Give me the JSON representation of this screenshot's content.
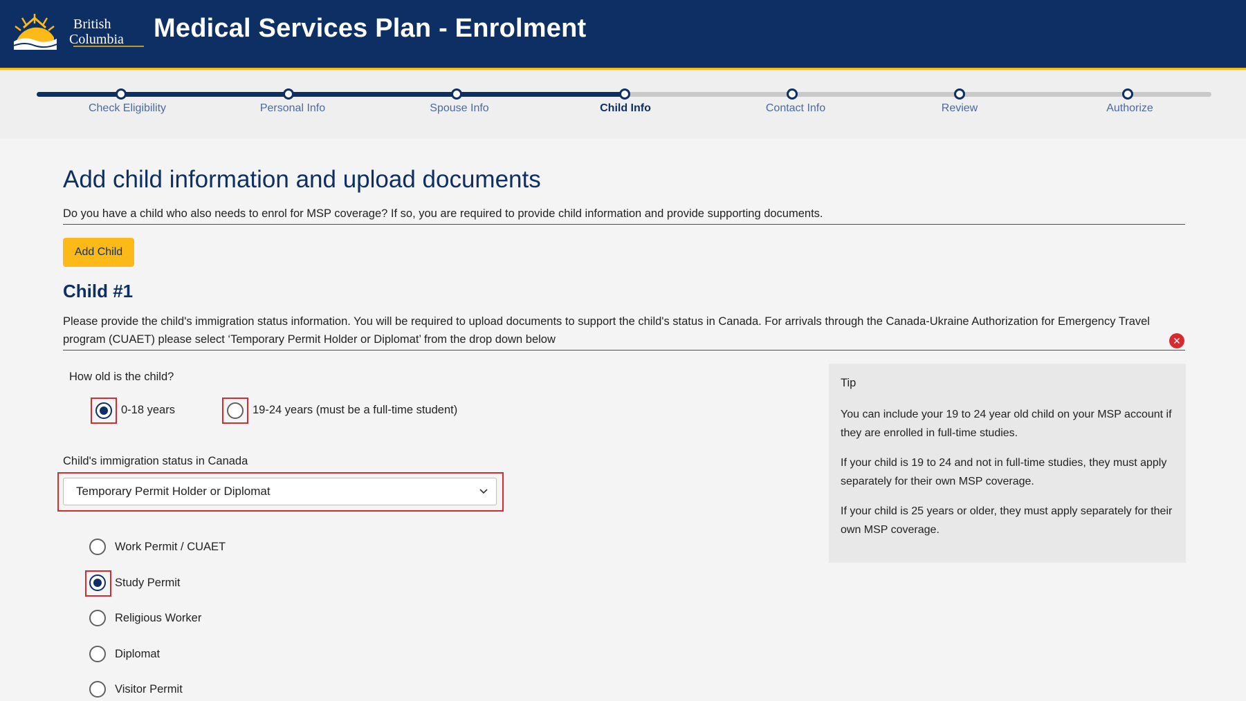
{
  "header": {
    "logo_line1": "British",
    "logo_line2": "Columbia",
    "title": "Medical Services Plan - Enrolment"
  },
  "stepper": {
    "steps": [
      {
        "label": "Check Eligibility",
        "state": "complete"
      },
      {
        "label": "Personal Info",
        "state": "complete"
      },
      {
        "label": "Spouse Info",
        "state": "complete"
      },
      {
        "label": "Child Info",
        "state": "current"
      },
      {
        "label": "Contact Info",
        "state": "upcoming"
      },
      {
        "label": "Review",
        "state": "upcoming"
      },
      {
        "label": "Authorize",
        "state": "upcoming"
      }
    ]
  },
  "main": {
    "title": "Add child information and upload documents",
    "intro": "Do you have a child who also needs to enrol for MSP coverage? If so, you are required to provide child information and provide supporting documents.",
    "add_child_label": "Add Child",
    "child_title": "Child #1",
    "child_desc": "Please provide the child's immigration status information. You will be required to upload documents to support the child's status in Canada. For arrivals through the Canada-Ukraine Authorization for Emergency Travel program (CUAET) please select ‘Temporary Permit Holder or Diplomat’ from the drop down below",
    "remove_icon": "close-circle-icon",
    "age_question": "How old is the child?",
    "age_options": [
      {
        "label": "0-18 years",
        "checked": true
      },
      {
        "label": "19-24 years (must be a full-time student)",
        "checked": false
      }
    ],
    "status_label": "Child's immigration status in Canada",
    "status_selected": "Temporary Permit Holder or Diplomat",
    "permit_options": [
      {
        "label": "Work Permit / CUAET",
        "checked": false
      },
      {
        "label": "Study Permit",
        "checked": true
      },
      {
        "label": "Religious Worker",
        "checked": false
      },
      {
        "label": "Diplomat",
        "checked": false
      },
      {
        "label": "Visitor Permit",
        "checked": false
      }
    ]
  },
  "tip": {
    "title": "Tip",
    "paragraphs": [
      "You can include your 19 to 24 year old child on your MSP account if they are enrolled in full-time studies.",
      "If your child is 19 to 24 and not in full-time studies, they must apply separately for their own MSP coverage.",
      "If your child is 25 years or older, they must apply separately for their own MSP coverage."
    ]
  },
  "colors": {
    "brand_navy": "#0d2f63",
    "accent_gold": "#fcba19",
    "highlight_red": "#d8292f"
  }
}
